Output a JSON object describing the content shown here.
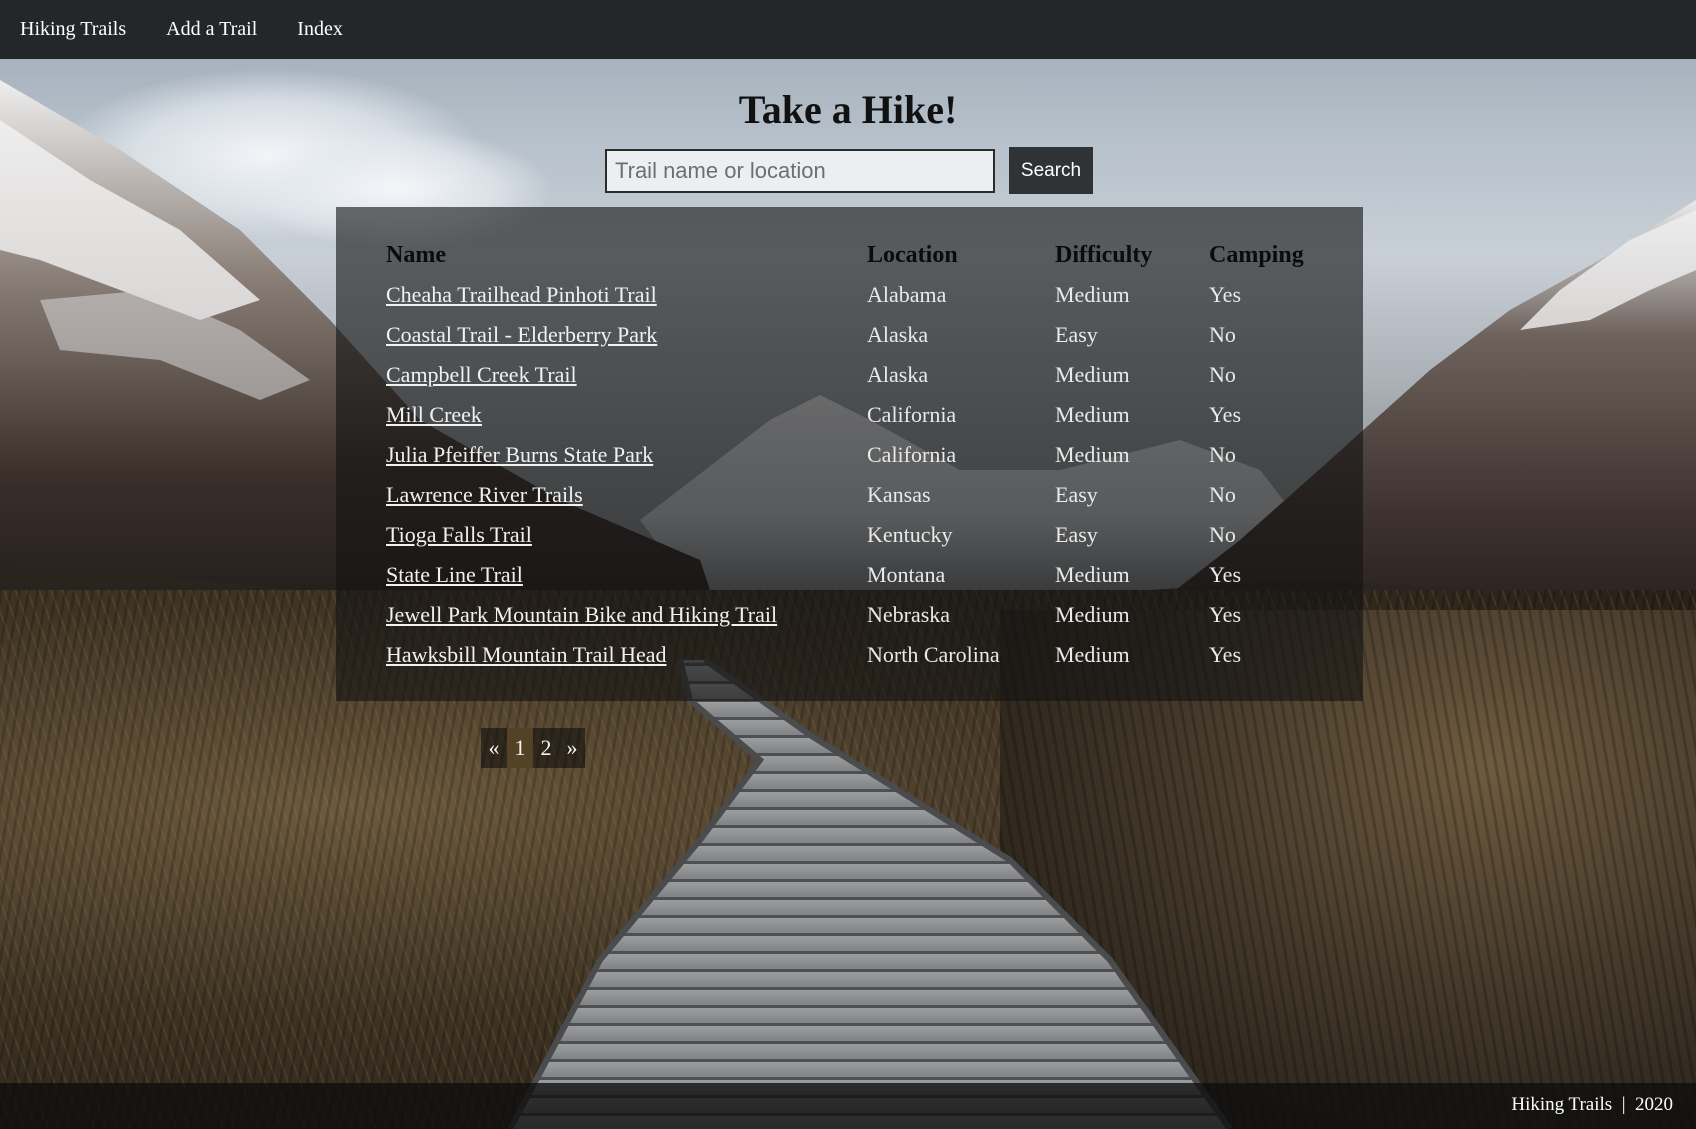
{
  "navbar": {
    "items": [
      {
        "label": "Hiking Trails"
      },
      {
        "label": "Add a Trail"
      },
      {
        "label": "Index"
      }
    ]
  },
  "main": {
    "title": "Take a Hike!",
    "search": {
      "placeholder": "Trail name or location",
      "value": "",
      "button_label": "Search"
    }
  },
  "table": {
    "headers": {
      "name": "Name",
      "location": "Location",
      "difficulty": "Difficulty",
      "camping": "Camping"
    },
    "rows": [
      {
        "name": "Cheaha Trailhead Pinhoti Trail",
        "location": "Alabama",
        "difficulty": "Medium",
        "camping": "Yes"
      },
      {
        "name": "Coastal Trail - Elderberry Park",
        "location": "Alaska",
        "difficulty": "Easy",
        "camping": "No"
      },
      {
        "name": "Campbell Creek Trail",
        "location": "Alaska",
        "difficulty": "Medium",
        "camping": "No"
      },
      {
        "name": "Mill Creek",
        "location": "California",
        "difficulty": "Medium",
        "camping": "Yes"
      },
      {
        "name": "Julia Pfeiffer Burns State Park",
        "location": "California",
        "difficulty": "Medium",
        "camping": "No"
      },
      {
        "name": "Lawrence River Trails",
        "location": "Kansas",
        "difficulty": "Easy",
        "camping": "No"
      },
      {
        "name": "Tioga Falls Trail",
        "location": "Kentucky",
        "difficulty": "Easy",
        "camping": "No"
      },
      {
        "name": "State Line Trail",
        "location": "Montana",
        "difficulty": "Medium",
        "camping": "Yes"
      },
      {
        "name": "Jewell Park Mountain Bike and Hiking Trail",
        "location": "Nebraska",
        "difficulty": "Medium",
        "camping": "Yes"
      },
      {
        "name": "Hawksbill Mountain Trail Head",
        "location": "North Carolina",
        "difficulty": "Medium",
        "camping": "Yes"
      }
    ]
  },
  "pagination": {
    "prev": "«",
    "pages": [
      "1",
      "2"
    ],
    "active_page": "1",
    "next": "»"
  },
  "footer": {
    "text": "Hiking Trails  |  2020"
  },
  "colors": {
    "navbar": "#24272a",
    "panel": "#1a1a1a",
    "button": "#2f3336",
    "active_page": "#5a4828"
  }
}
